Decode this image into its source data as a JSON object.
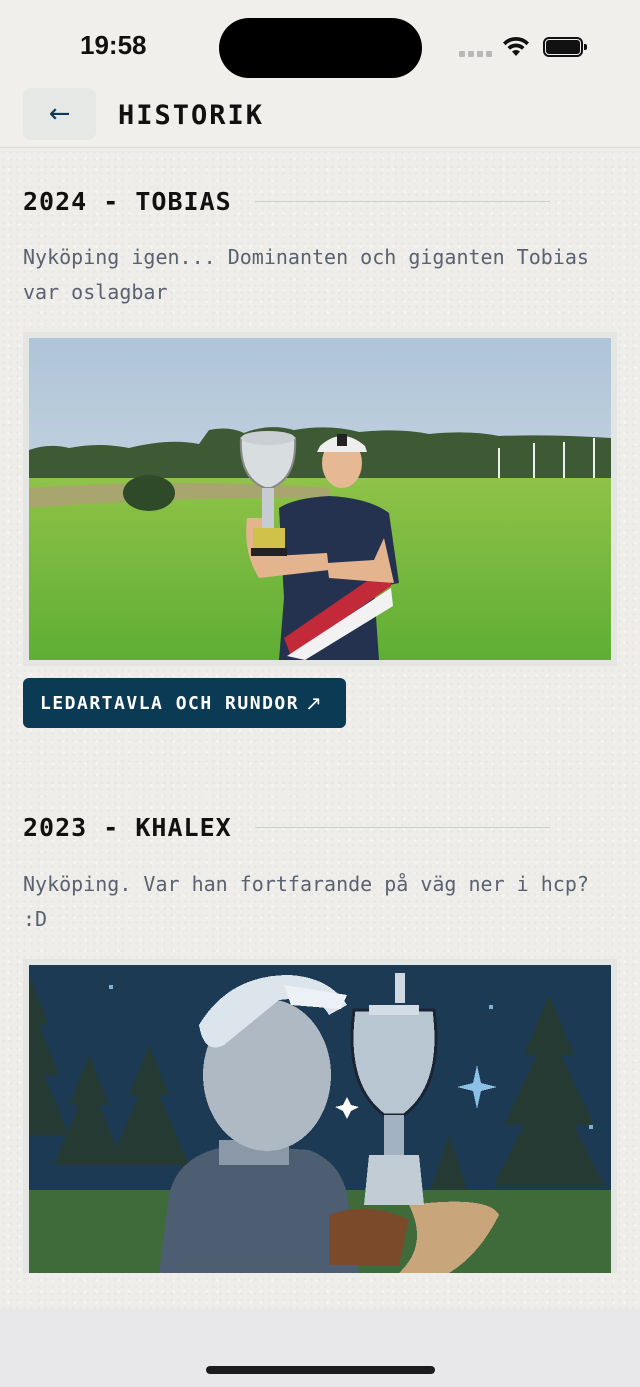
{
  "status_bar": {
    "time": "19:58",
    "icons": [
      "cellular-signal-icon",
      "wifi-icon",
      "battery-icon"
    ]
  },
  "header": {
    "back_icon": "←",
    "title": "HISTORIK"
  },
  "entries": [
    {
      "title": "2024 - TOBIAS",
      "description": "Nyköping igen... Dominanten och giganten Tobias var oslagbar",
      "image": "photo of winner holding trophy on golf course",
      "button_label": "LEDARTAVLA OCH RUNDOR",
      "button_icon": "↗"
    },
    {
      "title": "2023 - KHALEX",
      "description": "Nyköping. Var han fortfarande på väg ner i hcp? :D",
      "image": "pixel art of golfer holding trophy at night"
    }
  ],
  "colors": {
    "background": "#f0efeb",
    "accent": "#0b3a55",
    "description_text": "#5a6170",
    "back_button_bg": "#e5e8e4"
  }
}
